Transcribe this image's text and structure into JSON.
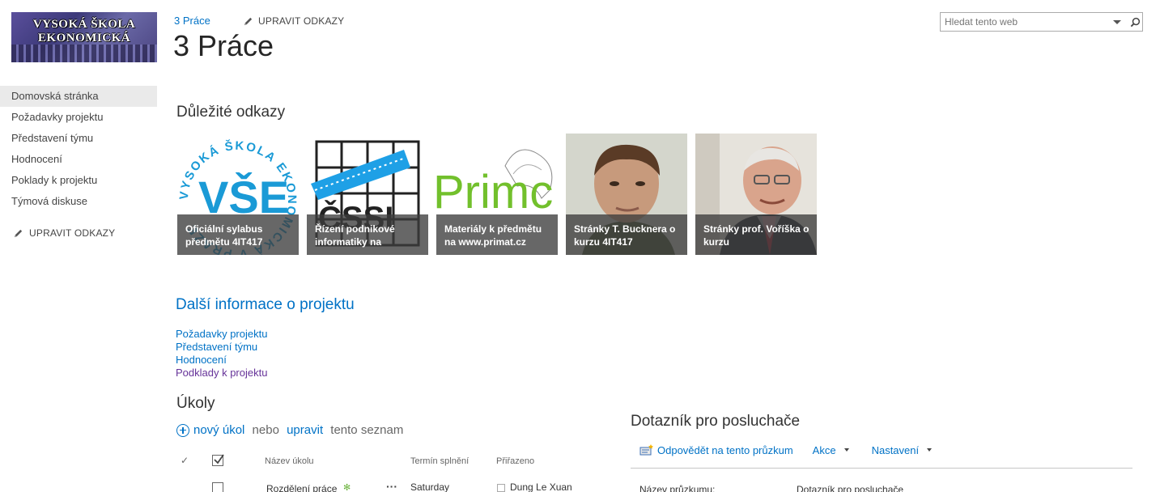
{
  "header": {
    "logo_text": "VYSOKÁ ŠKOLA EKONOMICKÁ",
    "breadcrumb": "3 Práce",
    "edit_links": "UPRAVIT ODKAZY",
    "page_title": "3 Práce"
  },
  "search": {
    "placeholder": "Hledat tento web"
  },
  "nav": {
    "items": [
      {
        "label": "Domovská stránka"
      },
      {
        "label": "Požadavky projektu"
      },
      {
        "label": "Představení týmu"
      },
      {
        "label": "Hodnocení"
      },
      {
        "label": "Poklady k projektu"
      },
      {
        "label": "Týmová diskuse"
      }
    ],
    "edit_links": "UPRAVIT ODKAZY"
  },
  "important_links": {
    "title": "Důležité odkazy",
    "tiles": [
      {
        "caption": "Oficiální sylabus předmětu 4IT417",
        "logo_text": "VŠE",
        "ring_text": "VYSOKÁ ŠKOLA EKONOMICKÁ V PRAZE"
      },
      {
        "caption": "Řízení podnikové informatiky na",
        "logo_text": "ČSSI"
      },
      {
        "caption": "Materiály k předmětu na www.primat.cz",
        "logo_text": "Primc"
      },
      {
        "caption": "Stránky T. Bucknera o kurzu 4IT417"
      },
      {
        "caption": "Stránky prof. Voříška o kurzu"
      }
    ]
  },
  "more_info": {
    "title": "Další informace o projektu",
    "links": [
      {
        "label": "Požadavky projektu"
      },
      {
        "label": "Představení týmu"
      },
      {
        "label": "Hodnocení"
      },
      {
        "label": "Podklady k projektu"
      }
    ]
  },
  "tasks": {
    "title": "Úkoly",
    "new_task": "nový úkol",
    "or": " nebo ",
    "edit": "upravit",
    "list_suffix": " tento seznam",
    "check_glyph": "✓",
    "columns": {
      "name": "Název úkolu",
      "due": "Termín splnění",
      "assigned": "Přiřazeno"
    },
    "rows": [
      {
        "name": "Rozdělení práce",
        "due": "Saturday",
        "assigned": "Dung Le Xuan",
        "menu": "···",
        "new_glyph": "✻"
      }
    ]
  },
  "survey": {
    "title": "Dotazník pro posluchače",
    "respond": "Odpovědět na tento průzkum",
    "actions": "Akce",
    "settings": "Nastavení",
    "name_label": "Název průzkumu:",
    "name_value": "Dotazník pro posluchače"
  },
  "colors": {
    "link": "#0072c6",
    "visited": "#663399",
    "caption_bg": "#3c3c3c"
  }
}
